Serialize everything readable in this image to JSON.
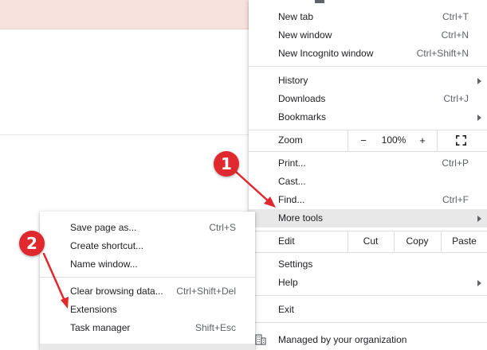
{
  "menu": {
    "new_tab": {
      "label": "New tab",
      "shortcut": "Ctrl+T"
    },
    "new_window": {
      "label": "New window",
      "shortcut": "Ctrl+N"
    },
    "new_incognito": {
      "label": "New Incognito window",
      "shortcut": "Ctrl+Shift+N"
    },
    "history": {
      "label": "History"
    },
    "downloads": {
      "label": "Downloads",
      "shortcut": "Ctrl+J"
    },
    "bookmarks": {
      "label": "Bookmarks"
    },
    "zoom": {
      "label": "Zoom",
      "minus": "−",
      "value": "100%",
      "plus": "+"
    },
    "print": {
      "label": "Print...",
      "shortcut": "Ctrl+P"
    },
    "cast": {
      "label": "Cast..."
    },
    "find": {
      "label": "Find...",
      "shortcut": "Ctrl+F"
    },
    "more_tools": {
      "label": "More tools"
    },
    "edit": {
      "label": "Edit",
      "cut": "Cut",
      "copy": "Copy",
      "paste": "Paste"
    },
    "settings": {
      "label": "Settings"
    },
    "help": {
      "label": "Help"
    },
    "exit": {
      "label": "Exit"
    },
    "managed": {
      "label": "Managed by your organization"
    }
  },
  "submenu": {
    "save_page": {
      "label": "Save page as...",
      "shortcut": "Ctrl+S"
    },
    "create_shortcut": {
      "label": "Create shortcut..."
    },
    "name_window": {
      "label": "Name window..."
    },
    "clear_browsing": {
      "label": "Clear browsing data...",
      "shortcut": "Ctrl+Shift+Del"
    },
    "extensions": {
      "label": "Extensions"
    },
    "task_manager": {
      "label": "Task manager",
      "shortcut": "Shift+Esc"
    }
  },
  "annotations": {
    "step1": "1",
    "step2": "2"
  },
  "colors": {
    "annotation_red": "#e0292e",
    "highlight": "#e8e8e8",
    "top_bar": "#f7e1dc"
  },
  "icons": {
    "fullscreen": "fullscreen-icon",
    "submenu_arrow": "chevron-right-icon",
    "managed": "building-icon"
  }
}
